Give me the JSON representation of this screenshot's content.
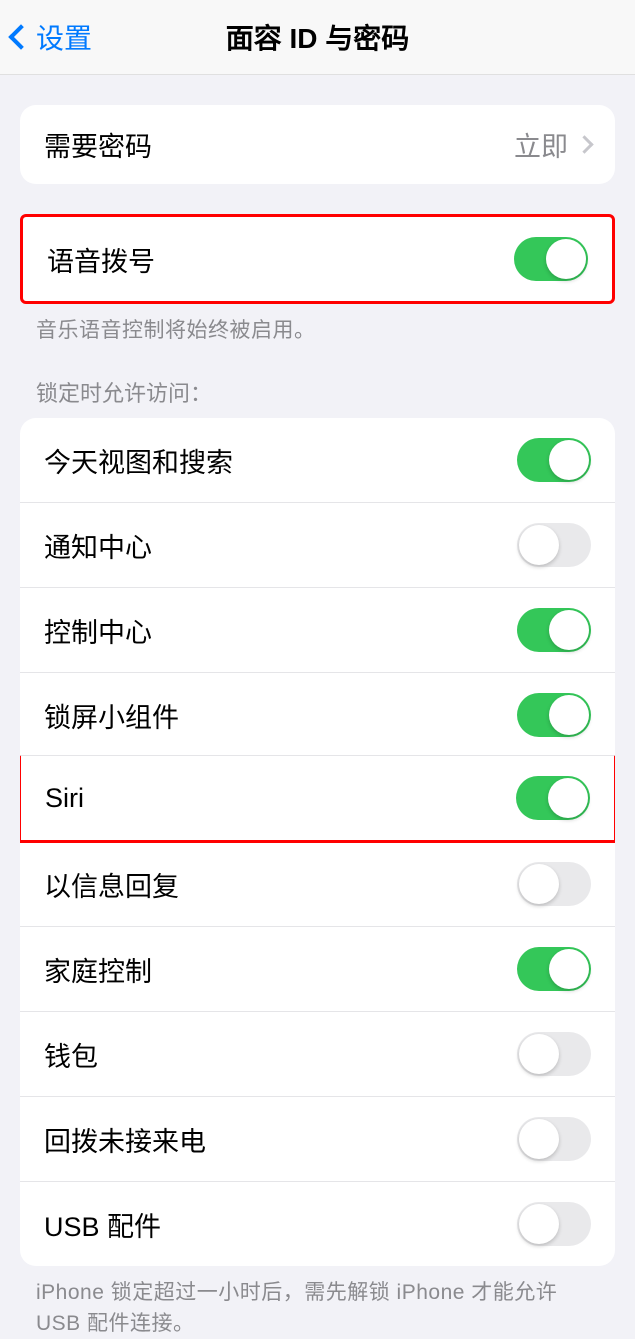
{
  "header": {
    "back_label": "设置",
    "title": "面容 ID 与密码"
  },
  "require_passcode": {
    "label": "需要密码",
    "value": "立即"
  },
  "voice_dial": {
    "label": "语音拨号",
    "on": true,
    "footer": "音乐语音控制将始终被启用。"
  },
  "lock_access": {
    "header": "锁定时允许访问：",
    "items": [
      {
        "label": "今天视图和搜索",
        "on": true,
        "highlighted": false
      },
      {
        "label": "通知中心",
        "on": false,
        "highlighted": false
      },
      {
        "label": "控制中心",
        "on": true,
        "highlighted": false
      },
      {
        "label": "锁屏小组件",
        "on": true,
        "highlighted": false
      },
      {
        "label": "Siri",
        "on": true,
        "highlighted": true
      },
      {
        "label": "以信息回复",
        "on": false,
        "highlighted": false
      },
      {
        "label": "家庭控制",
        "on": true,
        "highlighted": false
      },
      {
        "label": "钱包",
        "on": false,
        "highlighted": false
      },
      {
        "label": "回拨未接来电",
        "on": false,
        "highlighted": false
      },
      {
        "label": "USB 配件",
        "on": false,
        "highlighted": false
      }
    ],
    "footer": "iPhone 锁定超过一小时后，需先解锁 iPhone 才能允许 USB 配件连接。"
  }
}
